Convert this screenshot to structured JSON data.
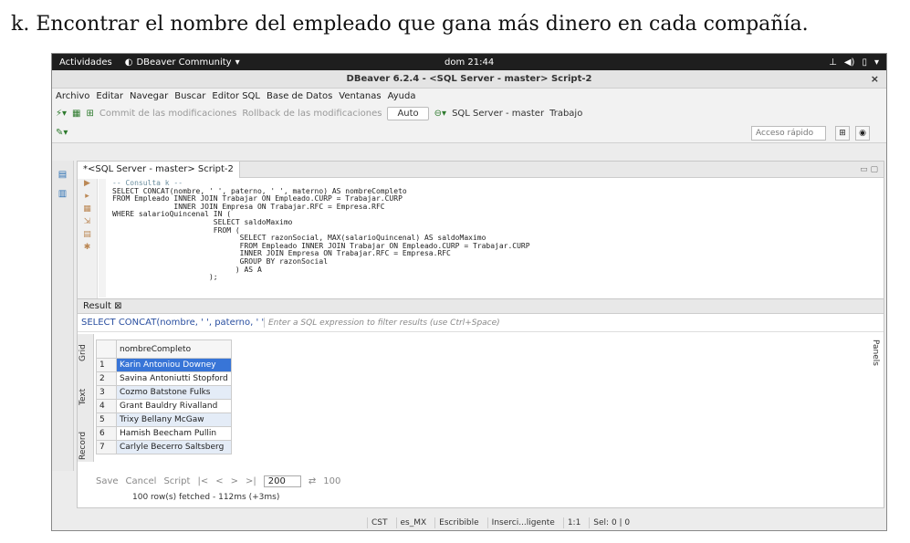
{
  "heading": "k. Encontrar el nombre del empleado que gana más dinero en cada compañía.",
  "topbar": {
    "activities": "Actividades",
    "app_name": "DBeaver Community",
    "clock": "dom 21:44"
  },
  "window": {
    "title": "DBeaver 6.2.4 - <SQL Server - master> Script-2",
    "close": "×"
  },
  "menu": [
    "Archivo",
    "Editar",
    "Navegar",
    "Buscar",
    "Editor SQL",
    "Base de Datos",
    "Ventanas",
    "Ayuda"
  ],
  "toolbar": {
    "commit": "Commit de las modificaciones",
    "rollback": "Rollback de las modificaciones",
    "mode": "Auto",
    "connection": "SQL Server - master",
    "workspace": "Trabajo"
  },
  "quick_access": "Acceso rápido",
  "editor": {
    "tab": "*<SQL Server - master> Script-2",
    "code": [
      {
        "cls": "cm",
        "t": "-- Consulta k --"
      },
      {
        "t": "SELECT CONCAT(nombre, ' ', paterno, ' ', materno) AS nombreCompleto"
      },
      {
        "t": "FROM Empleado INNER JOIN Trabajar ON Empleado.CURP = Trabajar.CURP"
      },
      {
        "t": "              INNER JOIN Empresa ON Trabajar.RFC = Empresa.RFC"
      },
      {
        "t": "WHERE salarioQuincenal IN ("
      },
      {
        "t": "                       SELECT saldoMaximo"
      },
      {
        "t": "                       FROM ("
      },
      {
        "t": "                             SELECT razonSocial, MAX(salarioQuincenal) AS saldoMaximo"
      },
      {
        "t": "                             FROM Empleado INNER JOIN Trabajar ON Empleado.CURP = Trabajar.CURP"
      },
      {
        "t": "                             INNER JOIN Empresa ON Trabajar.RFC = Empresa.RFC"
      },
      {
        "t": "                             GROUP BY razonSocial"
      },
      {
        "t": "                            ) AS A"
      },
      {
        "t": "                      );"
      }
    ]
  },
  "results": {
    "tab": "Result ⊠",
    "query": "SELECT CONCAT(nombre, ' ', paterno, ' ', mater",
    "filter_placeholder": "Enter a SQL expression to filter results (use Ctrl+Space)",
    "column": "nombreCompleto",
    "rows": [
      {
        "n": "1",
        "v": "Karin Antoniou Downey"
      },
      {
        "n": "2",
        "v": "Savina Antoniutti Stopford"
      },
      {
        "n": "3",
        "v": "Cozmo Batstone Fulks"
      },
      {
        "n": "4",
        "v": "Grant Bauldry Rivalland"
      },
      {
        "n": "5",
        "v": "Trixy Bellany McGaw"
      },
      {
        "n": "6",
        "v": "Hamish Beecham Pullin"
      },
      {
        "n": "7",
        "v": "Carlyle Becerro Saltsberg"
      }
    ],
    "vtabs": [
      "Grid",
      "Text",
      "Record"
    ],
    "panels": "Panels",
    "save": "Save",
    "cancel": "Cancel",
    "script": "Script",
    "fetch_size": "200",
    "refresh_count": "100",
    "fetched": "100 row(s) fetched - 112ms (+3ms)"
  },
  "status": [
    "CST",
    "es_MX",
    "Escribible",
    "Inserci...ligente",
    "1:1",
    "Sel: 0 | 0"
  ]
}
